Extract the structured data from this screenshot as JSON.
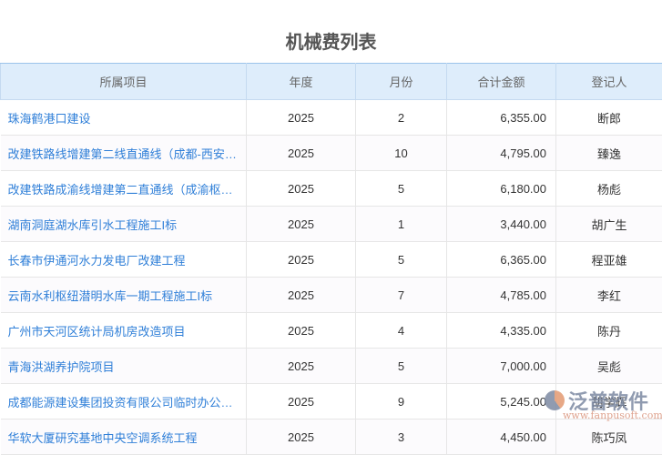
{
  "title": "机械费列表",
  "columns": [
    "所属项目",
    "年度",
    "月份",
    "合计金额",
    "登记人"
  ],
  "rows": [
    {
      "project": "珠海鹤港口建设",
      "year": "2025",
      "month": "2",
      "amount": "6,355.00",
      "person": "断郎"
    },
    {
      "project": "改建铁路线增建第二线直通线（成都-西安…",
      "year": "2025",
      "month": "10",
      "amount": "4,795.00",
      "person": "臻逸"
    },
    {
      "project": "改建铁路成渝线增建第二直通线（成渝枢…",
      "year": "2025",
      "month": "5",
      "amount": "6,180.00",
      "person": "杨彪"
    },
    {
      "project": "湖南洞庭湖水库引水工程施工I标",
      "year": "2025",
      "month": "1",
      "amount": "3,440.00",
      "person": "胡广生"
    },
    {
      "project": "长春市伊通河水力发电厂改建工程",
      "year": "2025",
      "month": "5",
      "amount": "6,365.00",
      "person": "程亚雄"
    },
    {
      "project": "云南水利枢纽潜明水库一期工程施工I标",
      "year": "2025",
      "month": "7",
      "amount": "4,785.00",
      "person": "李红"
    },
    {
      "project": "广州市天河区统计局机房改造项目",
      "year": "2025",
      "month": "4",
      "amount": "4,335.00",
      "person": "陈丹"
    },
    {
      "project": "青海洪湖养护院项目",
      "year": "2025",
      "month": "5",
      "amount": "7,000.00",
      "person": "吴彪"
    },
    {
      "project": "成都能源建设集团投资有限公司临时办公…",
      "year": "2025",
      "month": "9",
      "amount": "5,245.00",
      "person": "胡学辉"
    },
    {
      "project": "华软大厦研究基地中央空调系统工程",
      "year": "2025",
      "month": "3",
      "amount": "4,450.00",
      "person": "陈巧凤"
    }
  ],
  "watermark": {
    "brand": "泛普软件",
    "url": "www.fanpusoft.com"
  }
}
